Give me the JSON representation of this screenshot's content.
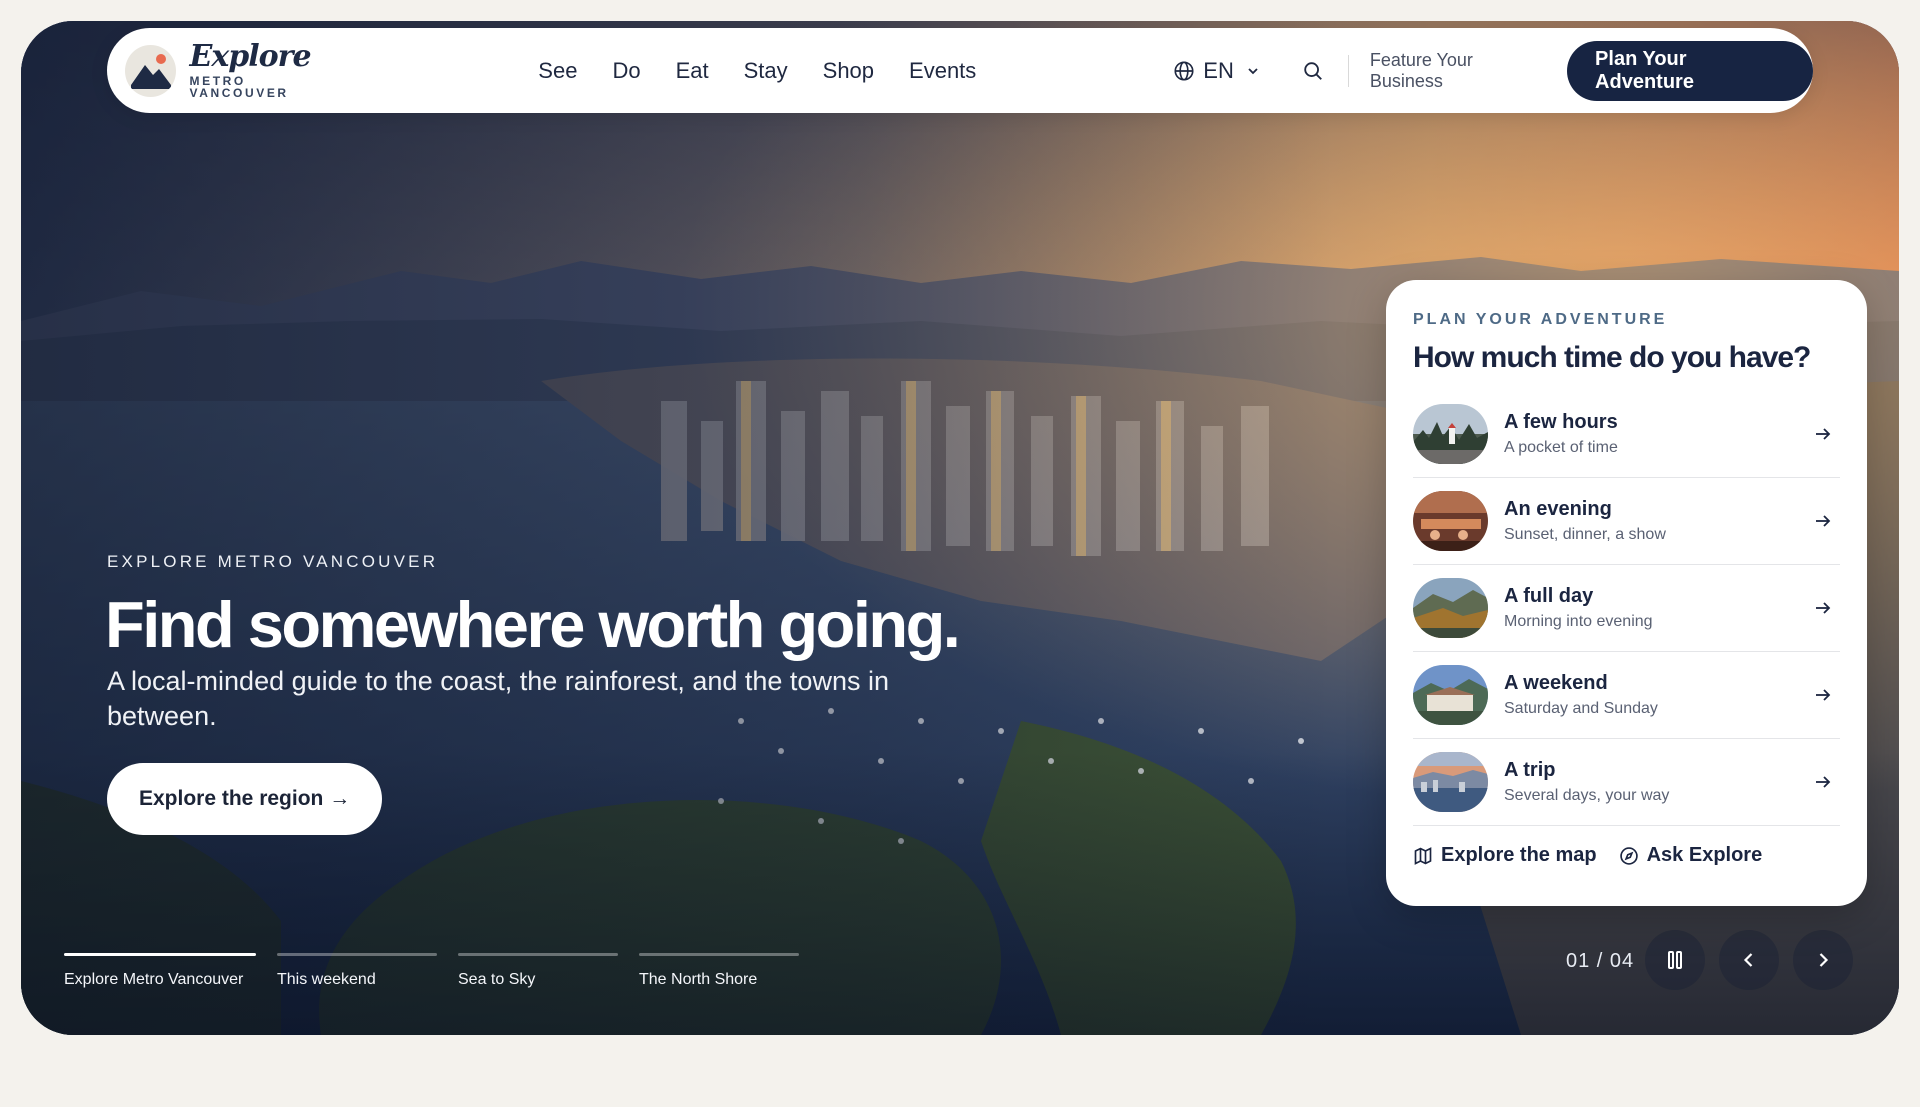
{
  "brand": {
    "name": "Explore",
    "tagline": "METRO VANCOUVER"
  },
  "nav": {
    "links": [
      "See",
      "Do",
      "Eat",
      "Stay",
      "Shop",
      "Events"
    ],
    "language": "EN",
    "feature_link": "Feature Your Business",
    "cta": "Plan Your Adventure",
    "icons": {
      "language": "globe-icon",
      "dropdown": "chevron-down-icon",
      "search": "search-icon"
    }
  },
  "hero": {
    "eyebrow": "EXPLORE METRO VANCOUVER",
    "headline": "Find somewhere worth going.",
    "subline": "A local-minded guide to the coast, the rainforest, and the towns in between.",
    "cta": "Explore the region →"
  },
  "slides": {
    "items": [
      "Explore Metro Vancouver",
      "This weekend",
      "Sea to Sky",
      "The North Shore"
    ],
    "active_index": 0,
    "counter": "01 / 04",
    "icons": {
      "pause": "pause-icon",
      "previous": "chevron-left-icon",
      "next": "chevron-right-icon"
    }
  },
  "planner": {
    "eyebrow": "PLAN YOUR ADVENTURE",
    "title": "How much time do you have?",
    "options": [
      {
        "title": "A few hours",
        "subtitle": "A pocket of time"
      },
      {
        "title": "An evening",
        "subtitle": "Sunset, dinner, a show"
      },
      {
        "title": "A full day",
        "subtitle": "Morning into evening"
      },
      {
        "title": "A weekend",
        "subtitle": "Saturday and Sunday"
      },
      {
        "title": "A trip",
        "subtitle": "Several days, your way"
      }
    ],
    "footer": {
      "map_link": "Explore the map",
      "ask_link": "Ask Explore",
      "icons": {
        "map": "map-icon",
        "ask": "compass-icon"
      }
    }
  },
  "colors": {
    "page_background": "#f4f2ed",
    "navy": "#172442",
    "card": "#ffffff",
    "sky_orange": "#e9834f"
  }
}
